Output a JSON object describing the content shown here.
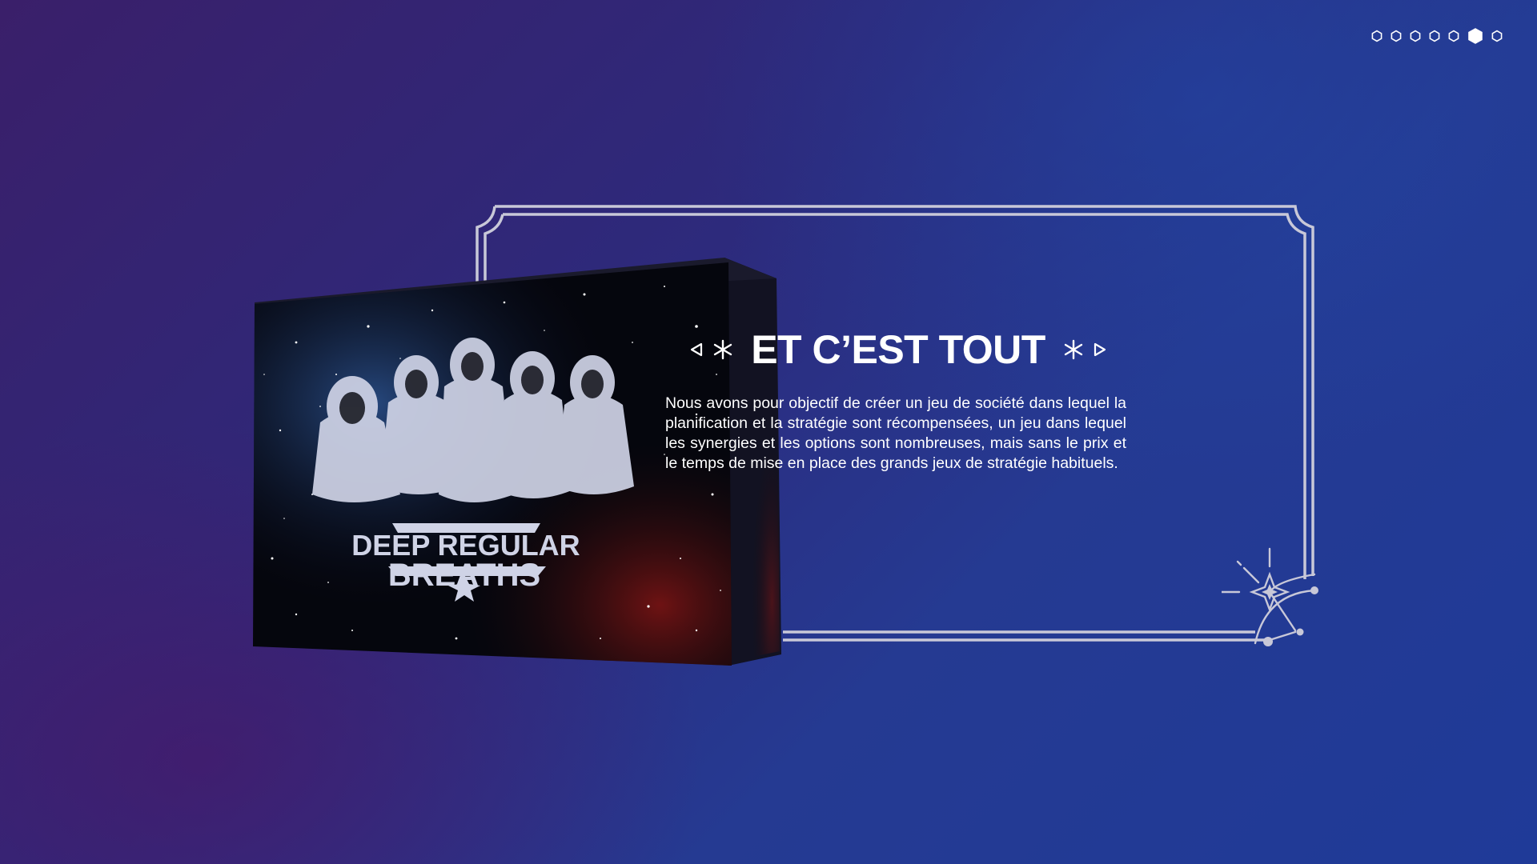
{
  "pager": {
    "count": 7,
    "active_index": 5,
    "dot_color": "#ffffff"
  },
  "slide": {
    "title": "ET C’EST TOUT",
    "body": "Nous avons pour objectif de créer un jeu de société dans lequel la planification et la stratégie sont récompensées, un jeu dans lequel les synergies et les options sont nombreuses, mais sans le prix et le temps de mise en place des grands jeux de stratégie habituels."
  },
  "game_box": {
    "logo_line1": "DEEP REGULAR",
    "logo_line2": "BREATHS"
  },
  "colors": {
    "frame": "#c8c8d8",
    "text": "#ffffff",
    "background_top": "#1f3a98",
    "background_bottom": "#3a1f6a"
  },
  "icons": {
    "left_arrow": "triangle-left-outline-icon",
    "right_arrow": "triangle-right-outline-icon",
    "sparkle": "asterisk-star-icon",
    "corner_star": "compass-star-icon"
  }
}
